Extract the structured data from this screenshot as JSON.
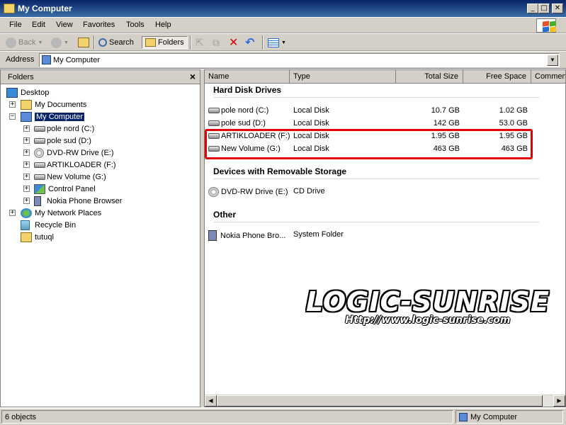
{
  "window": {
    "title": "My Computer"
  },
  "menu": [
    "File",
    "Edit",
    "View",
    "Favorites",
    "Tools",
    "Help"
  ],
  "toolbar": {
    "back": "Back",
    "search": "Search",
    "folders": "Folders"
  },
  "address": {
    "label": "Address",
    "value": "My Computer"
  },
  "folders_pane": {
    "title": "Folders",
    "items": [
      {
        "label": "Desktop"
      },
      {
        "label": "My Documents"
      },
      {
        "label": "My Computer"
      },
      {
        "label": "pole nord (C:)"
      },
      {
        "label": "pole sud (D:)"
      },
      {
        "label": "DVD-RW Drive (E:)"
      },
      {
        "label": "ARTIKLOADER (F:)"
      },
      {
        "label": "New Volume (G:)"
      },
      {
        "label": "Control Panel"
      },
      {
        "label": "Nokia Phone Browser"
      },
      {
        "label": "My Network Places"
      },
      {
        "label": "Recycle Bin"
      },
      {
        "label": "tutuql"
      }
    ]
  },
  "columns": {
    "name": "Name",
    "type": "Type",
    "total": "Total Size",
    "free": "Free Space",
    "comments": "Commen"
  },
  "groups": {
    "hdd": "Hard Disk Drives",
    "removable": "Devices with Removable Storage",
    "other": "Other"
  },
  "rows": [
    {
      "name": "pole nord (C:)",
      "type": "Local Disk",
      "total": "10.7 GB",
      "free": "1.02 GB"
    },
    {
      "name": "pole sud (D:)",
      "type": "Local Disk",
      "total": "142 GB",
      "free": "53.0 GB"
    },
    {
      "name": "ARTIKLOADER (F:)",
      "type": "Local Disk",
      "total": "1.95 GB",
      "free": "1.95 GB"
    },
    {
      "name": "New Volume (G:)",
      "type": "Local Disk",
      "total": "463 GB",
      "free": "463 GB"
    },
    {
      "name": "DVD-RW Drive (E:)",
      "type": "CD Drive",
      "total": "",
      "free": ""
    },
    {
      "name": "Nokia Phone Bro...",
      "type": "System Folder",
      "total": "",
      "free": ""
    }
  ],
  "watermark": {
    "line1": "LOGIC-SUNRISE",
    "line2": "Http://www.logic-sunrise.com"
  },
  "status": {
    "count": "6 objects",
    "location": "My Computer"
  },
  "colors": {
    "highlight": "#e00000",
    "selection": "#0a246a",
    "titlebar": "#0a246a"
  }
}
